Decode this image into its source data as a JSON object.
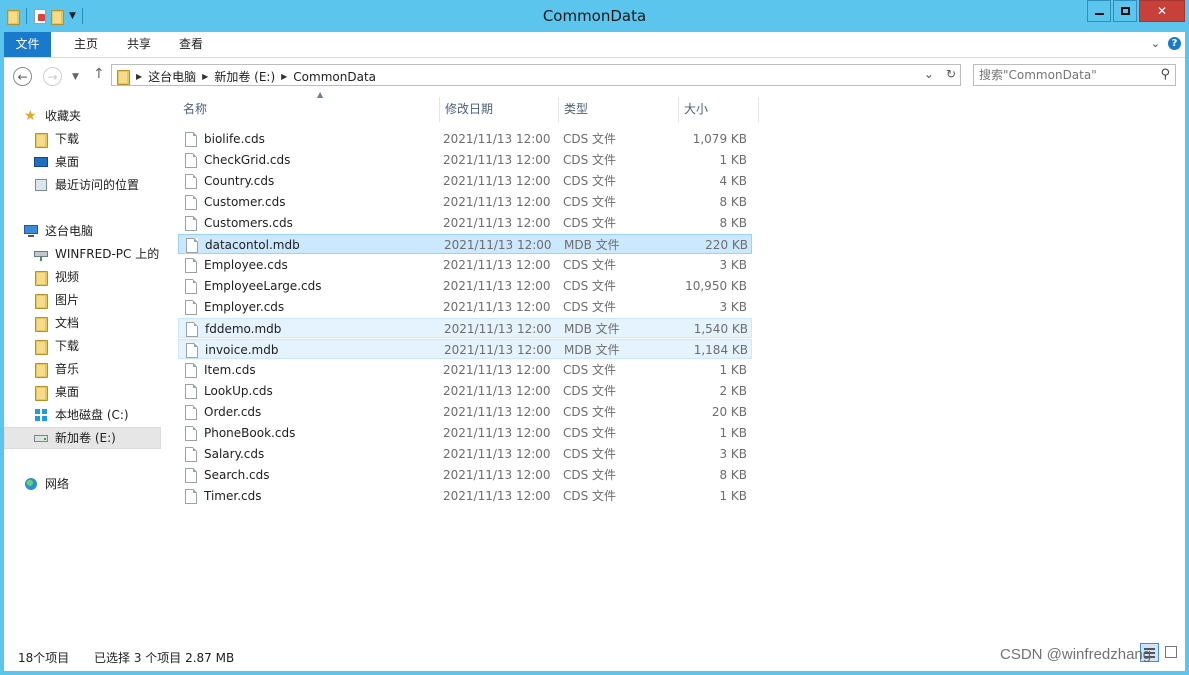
{
  "window": {
    "title": "CommonData"
  },
  "ribbon": {
    "tabs": [
      "文件",
      "主页",
      "共享",
      "查看"
    ]
  },
  "address": {
    "crumbs": [
      "这台电脑",
      "新加卷 (E:)",
      "CommonData"
    ]
  },
  "search": {
    "placeholder": "搜索\"CommonData\""
  },
  "nav": {
    "favorites": "收藏夹",
    "fav_items": [
      "下载",
      "桌面",
      "最近访问的位置"
    ],
    "this_pc": "这台电脑",
    "pc_items": [
      "WINFRED-PC 上的",
      "视频",
      "图片",
      "文档",
      "下载",
      "音乐",
      "桌面",
      "本地磁盘 (C:)",
      "新加卷 (E:)"
    ],
    "network": "网络"
  },
  "columns": {
    "name": "名称",
    "date": "修改日期",
    "type": "类型",
    "size": "大小"
  },
  "files": [
    {
      "name": "biolife.cds",
      "date": "2021/11/13 12:00",
      "type": "CDS 文件",
      "size": "1,079 KB",
      "selected": false
    },
    {
      "name": "CheckGrid.cds",
      "date": "2021/11/13 12:00",
      "type": "CDS 文件",
      "size": "1 KB",
      "selected": false
    },
    {
      "name": "Country.cds",
      "date": "2021/11/13 12:00",
      "type": "CDS 文件",
      "size": "4 KB",
      "selected": false
    },
    {
      "name": "Customer.cds",
      "date": "2021/11/13 12:00",
      "type": "CDS 文件",
      "size": "8 KB",
      "selected": false
    },
    {
      "name": "Customers.cds",
      "date": "2021/11/13 12:00",
      "type": "CDS 文件",
      "size": "8 KB",
      "selected": false
    },
    {
      "name": "datacontol.mdb",
      "date": "2021/11/13 12:00",
      "type": "MDB 文件",
      "size": "220 KB",
      "selected": true
    },
    {
      "name": "Employee.cds",
      "date": "2021/11/13 12:00",
      "type": "CDS 文件",
      "size": "3 KB",
      "selected": false
    },
    {
      "name": "EmployeeLarge.cds",
      "date": "2021/11/13 12:00",
      "type": "CDS 文件",
      "size": "10,950 KB",
      "selected": false
    },
    {
      "name": "Employer.cds",
      "date": "2021/11/13 12:00",
      "type": "CDS 文件",
      "size": "3 KB",
      "selected": false
    },
    {
      "name": "fddemo.mdb",
      "date": "2021/11/13 12:00",
      "type": "MDB 文件",
      "size": "1,540 KB",
      "selected": true
    },
    {
      "name": "invoice.mdb",
      "date": "2021/11/13 12:00",
      "type": "MDB 文件",
      "size": "1,184 KB",
      "selected": true
    },
    {
      "name": "Item.cds",
      "date": "2021/11/13 12:00",
      "type": "CDS 文件",
      "size": "1 KB",
      "selected": false
    },
    {
      "name": "LookUp.cds",
      "date": "2021/11/13 12:00",
      "type": "CDS 文件",
      "size": "2 KB",
      "selected": false
    },
    {
      "name": "Order.cds",
      "date": "2021/11/13 12:00",
      "type": "CDS 文件",
      "size": "20 KB",
      "selected": false
    },
    {
      "name": "PhoneBook.cds",
      "date": "2021/11/13 12:00",
      "type": "CDS 文件",
      "size": "1 KB",
      "selected": false
    },
    {
      "name": "Salary.cds",
      "date": "2021/11/13 12:00",
      "type": "CDS 文件",
      "size": "3 KB",
      "selected": false
    },
    {
      "name": "Search.cds",
      "date": "2021/11/13 12:00",
      "type": "CDS 文件",
      "size": "8 KB",
      "selected": false
    },
    {
      "name": "Timer.cds",
      "date": "2021/11/13 12:00",
      "type": "CDS 文件",
      "size": "1 KB",
      "selected": false
    }
  ],
  "status": {
    "count": "18个项目",
    "selection": "已选择 3 个项目  2.87 MB"
  },
  "watermark": "CSDN @winfredzhang",
  "colors": {
    "titlebar": "#5bc5ee",
    "file_tab": "#1979ca",
    "selection": "#cce8ff"
  }
}
